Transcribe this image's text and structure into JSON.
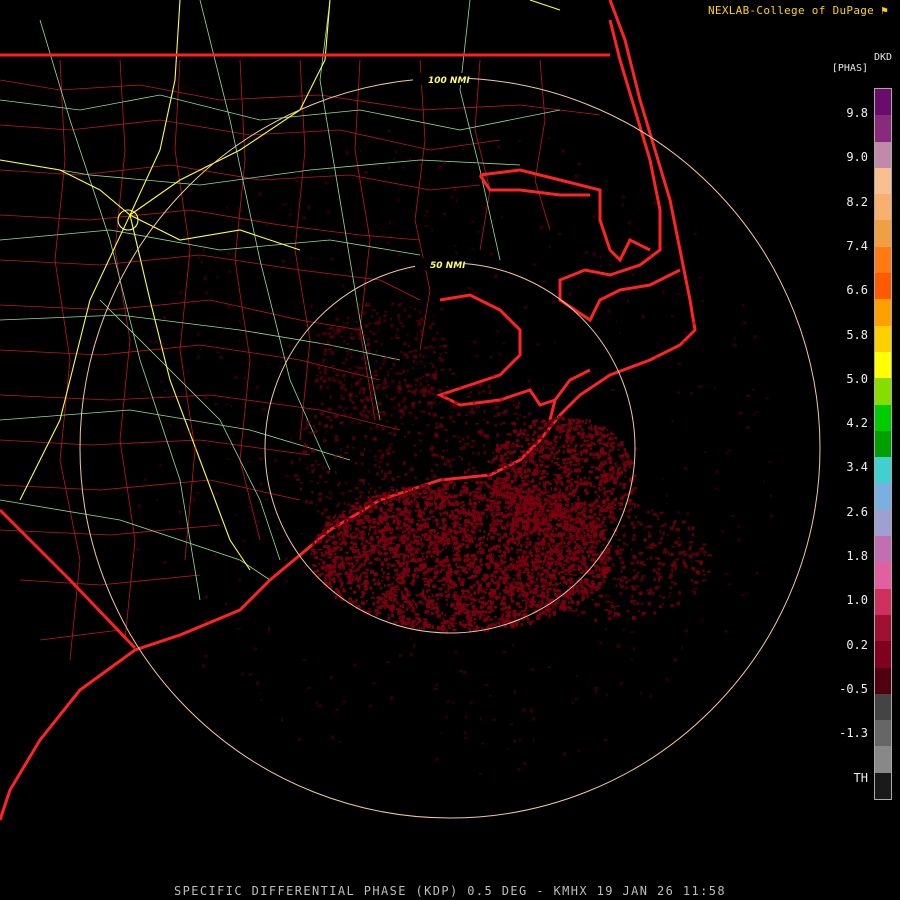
{
  "credit": "NEXLAB-College of DuPage",
  "credit_icon": "logo-flag-icon",
  "product": "SPECIFIC DIFFERENTIAL PHASE (KDP) 0.5 DEG - KMHX 19 JAN 26 11:58",
  "rings": [
    {
      "label": "50 NMI"
    },
    {
      "label": "100 NMI"
    }
  ],
  "legend": {
    "code": "DKD",
    "unit": "[PHAS]",
    "ticks": [
      "9.8",
      "9.0",
      "8.2",
      "7.4",
      "6.6",
      "5.8",
      "5.0",
      "4.2",
      "3.4",
      "2.6",
      "1.8",
      "1.0",
      "0.2",
      "-0.5",
      "-1.3",
      "TH"
    ],
    "colors": [
      "#6a0c6a",
      "#8a2a7a",
      "#c08aa8",
      "#f8c090",
      "#f8b070",
      "#f0a040",
      "#ff7a10",
      "#ff5a00",
      "#ffa000",
      "#ffd000",
      "#ffff00",
      "#88dd00",
      "#00cc00",
      "#00a000",
      "#40d0d0",
      "#7ab0e0",
      "#a0a0d0",
      "#c070b0",
      "#e060a0",
      "#d03060",
      "#a01030",
      "#800020",
      "#500010",
      "#444444",
      "#666666",
      "#888888",
      "#1a1a1a"
    ]
  },
  "colors": {
    "background": "#000000",
    "state_border": "#ff2020",
    "county": "#c01818",
    "highway": "#ffff40",
    "road": "#90e090",
    "ring": "#f0c8a0",
    "echo": "#7a0010"
  }
}
